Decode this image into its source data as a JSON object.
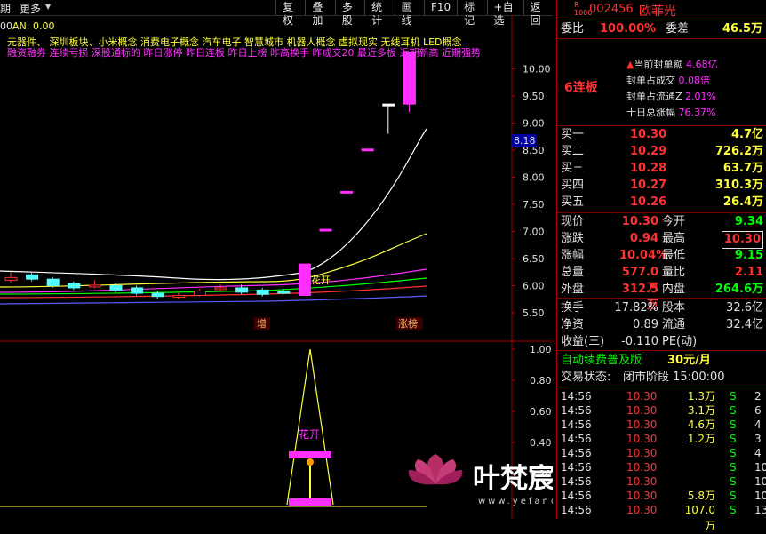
{
  "toolbar": {
    "period": "期",
    "more": "更多",
    "menus": [
      "复权",
      "叠加",
      "多股",
      "统计",
      "画线",
      "F10",
      "标记",
      "+自选",
      "返回"
    ]
  },
  "chart": {
    "indicator_header": "00",
    "an_label": "AN: 0.00",
    "concepts_line1": "元器件、 深圳板块、小米概念 消费电子概念 汽车电子 智慧城市 机器人概念 虚拟现实 无线耳机 LED概念",
    "concepts_line2": "融资融券 连续亏损 深股通标的 昨日涨停 昨日连板 昨日上榜 昨高换手 昨成交20 最近多板 近期新高 近期强势",
    "price_ticks": [
      "10.00",
      "9.50",
      "9.00",
      "8.50",
      "8.00",
      "7.50",
      "7.00",
      "6.50",
      "6.00",
      "5.50"
    ],
    "price_marker": "8.18",
    "ind_ticks": [
      "1.00",
      "0.80",
      "0.60",
      "0.40",
      "0.20"
    ],
    "tag_zeng": "增",
    "tag_zhangbang": "涨榜",
    "huakai_upper": "花开",
    "huakai_lower": "花开",
    "watermark_cn": "叶梵宸指标公式网",
    "watermark_url": "www.yefanchen.com",
    "candles": [
      {
        "o": 6.1,
        "c": 6.15,
        "h": 6.25,
        "l": 6.05,
        "col": "red"
      },
      {
        "o": 6.2,
        "c": 6.12,
        "h": 6.24,
        "l": 6.08,
        "col": "cyan"
      },
      {
        "o": 6.12,
        "c": 6.0,
        "h": 6.16,
        "l": 5.96,
        "col": "cyan"
      },
      {
        "o": 6.04,
        "c": 5.96,
        "h": 6.08,
        "l": 5.92,
        "col": "cyan"
      },
      {
        "o": 6.0,
        "c": 6.01,
        "h": 6.1,
        "l": 5.95,
        "col": "red"
      },
      {
        "o": 6.0,
        "c": 5.92,
        "h": 6.04,
        "l": 5.88,
        "col": "cyan"
      },
      {
        "o": 5.96,
        "c": 5.86,
        "h": 6.0,
        "l": 5.82,
        "col": "cyan"
      },
      {
        "o": 5.86,
        "c": 5.8,
        "h": 5.9,
        "l": 5.76,
        "col": "cyan"
      },
      {
        "o": 5.8,
        "c": 5.82,
        "h": 5.88,
        "l": 5.76,
        "col": "red"
      },
      {
        "o": 5.82,
        "c": 5.9,
        "h": 5.94,
        "l": 5.8,
        "col": "red"
      },
      {
        "o": 5.94,
        "c": 5.96,
        "h": 6.02,
        "l": 5.9,
        "col": "red"
      },
      {
        "o": 5.96,
        "c": 5.88,
        "h": 6.02,
        "l": 5.84,
        "col": "cyan"
      },
      {
        "o": 5.92,
        "c": 5.84,
        "h": 5.96,
        "l": 5.8,
        "col": "cyan"
      },
      {
        "o": 5.86,
        "c": 5.9,
        "h": 5.94,
        "l": 5.84,
        "col": "cyan"
      },
      {
        "o": 5.82,
        "c": 6.4,
        "h": 6.4,
        "l": 5.82,
        "col": "magenta"
      },
      {
        "o": 7.04,
        "c": 7.04,
        "h": 7.04,
        "l": 7.04,
        "col": "magenta"
      },
      {
        "o": 7.74,
        "c": 7.74,
        "h": 7.74,
        "l": 7.74,
        "col": "magenta"
      },
      {
        "o": 8.52,
        "c": 8.52,
        "h": 8.52,
        "l": 8.52,
        "col": "magenta"
      },
      {
        "o": 9.35,
        "c": 9.35,
        "h": 9.35,
        "l": 8.8,
        "col": "white"
      },
      {
        "o": 9.35,
        "c": 10.3,
        "h": 10.3,
        "l": 9.2,
        "col": "magenta"
      }
    ]
  },
  "quote": {
    "r_mark": "R",
    "r_sub": "1000",
    "code": "002456",
    "name": "欧菲光",
    "weibi_label": "委比",
    "weibi_value": "100.00%",
    "weicha_label": "委差",
    "weicha_value": "46.5万",
    "lianban": "6连板",
    "info": [
      {
        "label": "当前封单额",
        "value": "4.68亿"
      },
      {
        "label": "封单占成交",
        "value": "0.08倍"
      },
      {
        "label": "封单占流通Z",
        "value": "2.01%"
      },
      {
        "label": "十日总涨幅",
        "value": "76.37%"
      }
    ],
    "bids": [
      {
        "label": "买一",
        "price": "10.30",
        "vol": "4.7亿"
      },
      {
        "label": "买二",
        "price": "10.29",
        "vol": "726.2万"
      },
      {
        "label": "买三",
        "price": "10.28",
        "vol": "63.7万"
      },
      {
        "label": "买四",
        "price": "10.27",
        "vol": "310.3万"
      },
      {
        "label": "买五",
        "price": "10.26",
        "vol": "26.4万"
      }
    ],
    "stats": [
      {
        "l1": "现价",
        "v1": "10.30",
        "l2": "今开",
        "v2": "9.34",
        "v2c": "grn"
      },
      {
        "l1": "涨跌",
        "v1": "0.94",
        "l2": "最高",
        "v2": "10.30",
        "v2c": "red"
      },
      {
        "l1": "涨幅",
        "v1": "10.04%",
        "l2": "最低",
        "v2": "9.15",
        "v2c": "grn"
      },
      {
        "l1": "总量",
        "v1": "577.0万",
        "l2": "量比",
        "v2": "2.11",
        "v2c": "red"
      },
      {
        "l1": "外盘",
        "v1": "312.5万",
        "l2": "内盘",
        "v2": "264.6万",
        "v2c": "grn"
      }
    ],
    "fund": [
      {
        "l1": "换手",
        "v1": "17.82%",
        "l2": "股本",
        "v2": "32.6亿"
      },
      {
        "l1": "净资",
        "v1": "0.89",
        "l2": "流通",
        "v2": "32.4亿"
      },
      {
        "l1": "收益(三)",
        "v1": "-0.110",
        "l2": "PE(动)",
        "v2": ""
      }
    ],
    "promo_title": "自动续费普及版",
    "promo_price": "30元/月",
    "trade_state_label": "交易状态:",
    "trade_state_value": "闭市阶段 15:00:00",
    "trades": [
      {
        "t": "14:56",
        "p": "10.30",
        "v": "1.3万",
        "s": "S",
        "n": "2"
      },
      {
        "t": "14:56",
        "p": "10.30",
        "v": "3.1万",
        "s": "S",
        "n": "6"
      },
      {
        "t": "14:56",
        "p": "10.30",
        "v": "4.6万",
        "s": "S",
        "n": "4"
      },
      {
        "t": "14:56",
        "p": "10.30",
        "v": "1.2万",
        "s": "S",
        "n": "3"
      },
      {
        "t": "14:56",
        "p": "10.30",
        "v": "",
        "s": "S",
        "n": "4"
      },
      {
        "t": "14:56",
        "p": "10.30",
        "v": "",
        "s": "S",
        "n": "10"
      },
      {
        "t": "14:56",
        "p": "10.30",
        "v": "",
        "s": "S",
        "n": "10"
      },
      {
        "t": "14:56",
        "p": "10.30",
        "v": "5.8万",
        "s": "S",
        "n": "10"
      },
      {
        "t": "14:56",
        "p": "10.30",
        "v": "107.0万",
        "s": "S",
        "n": "13"
      }
    ],
    "colors": {
      "up": "#ff3232",
      "down": "#00ff00",
      "accent": "#ffff3c",
      "cyan": "#00ffff",
      "magenta": "#ff30ff",
      "border": "#b00000"
    }
  }
}
